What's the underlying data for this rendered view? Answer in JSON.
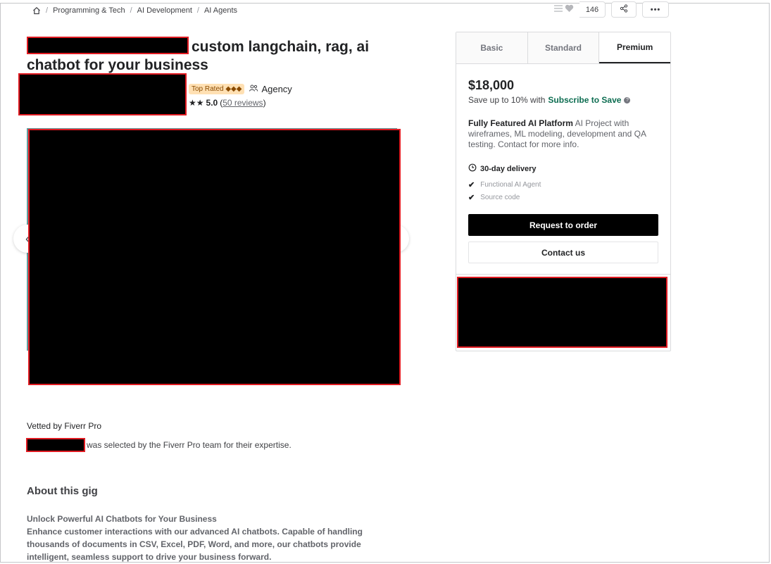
{
  "breadcrumb": {
    "home_icon": "home-icon",
    "items": [
      "Programming & Tech",
      "AI Development",
      "AI Agents"
    ],
    "separator": "/"
  },
  "actions": {
    "favorites_count": "146",
    "list_icon": "list-icon",
    "heart_icon": "heart-icon",
    "share_icon": "share-icon",
    "more_label": "•••"
  },
  "gig": {
    "title_suffix": "custom langchain, rag, ai chatbot for your business",
    "top_rated_label": "Top Rated ◆◆◆",
    "agency_label": "Agency",
    "stars": "★★",
    "rating": "5.0",
    "reviews": "50 reviews"
  },
  "vetted": {
    "heading": "Vetted by Fiverr Pro",
    "text": "was selected by the Fiverr Pro team for their expertise."
  },
  "about": {
    "heading": "About this gig",
    "subheading": "Unlock Powerful AI Chatbots for Your Business",
    "body": "Enhance customer interactions with our advanced AI chatbots. Capable of handling thousands of documents in CSV, Excel, PDF, Word, and more, our chatbots provide intelligent, seamless support to drive your business forward."
  },
  "pricing": {
    "tabs": [
      "Basic",
      "Standard",
      "Premium"
    ],
    "active_tab": "Premium",
    "price": "$18,000",
    "save_prefix": "Save up to 10% with",
    "save_link": "Subscribe to Save",
    "package_name": "Fully Featured AI Platform",
    "package_desc": "AI Project with wireframes, ML modeling, development and QA testing. Contact for more info.",
    "delivery": "30-day delivery",
    "features": [
      "Functional AI Agent",
      "Source code"
    ],
    "order_button": "Request to order",
    "contact_button": "Contact us"
  },
  "colors": {
    "brand_green": "#0d6d51",
    "redaction_border": "#e11b22",
    "top_rated_bg": "#ffe0b3"
  }
}
